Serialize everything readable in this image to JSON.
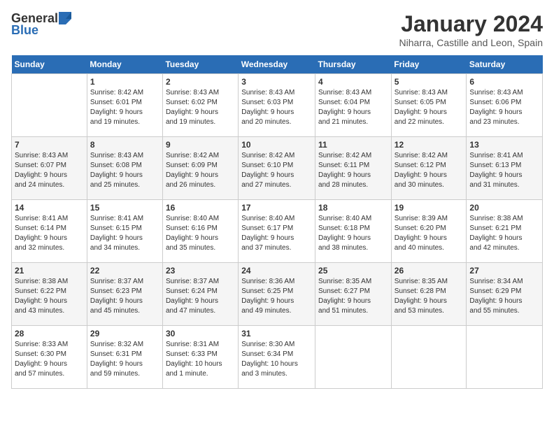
{
  "logo": {
    "general": "General",
    "blue": "Blue"
  },
  "title": "January 2024",
  "subtitle": "Niharra, Castille and Leon, Spain",
  "days_of_week": [
    "Sunday",
    "Monday",
    "Tuesday",
    "Wednesday",
    "Thursday",
    "Friday",
    "Saturday"
  ],
  "weeks": [
    [
      {
        "day": "",
        "info": ""
      },
      {
        "day": "1",
        "info": "Sunrise: 8:42 AM\nSunset: 6:01 PM\nDaylight: 9 hours\nand 19 minutes."
      },
      {
        "day": "2",
        "info": "Sunrise: 8:43 AM\nSunset: 6:02 PM\nDaylight: 9 hours\nand 19 minutes."
      },
      {
        "day": "3",
        "info": "Sunrise: 8:43 AM\nSunset: 6:03 PM\nDaylight: 9 hours\nand 20 minutes."
      },
      {
        "day": "4",
        "info": "Sunrise: 8:43 AM\nSunset: 6:04 PM\nDaylight: 9 hours\nand 21 minutes."
      },
      {
        "day": "5",
        "info": "Sunrise: 8:43 AM\nSunset: 6:05 PM\nDaylight: 9 hours\nand 22 minutes."
      },
      {
        "day": "6",
        "info": "Sunrise: 8:43 AM\nSunset: 6:06 PM\nDaylight: 9 hours\nand 23 minutes."
      }
    ],
    [
      {
        "day": "7",
        "info": "Sunrise: 8:43 AM\nSunset: 6:07 PM\nDaylight: 9 hours\nand 24 minutes."
      },
      {
        "day": "8",
        "info": "Sunrise: 8:43 AM\nSunset: 6:08 PM\nDaylight: 9 hours\nand 25 minutes."
      },
      {
        "day": "9",
        "info": "Sunrise: 8:42 AM\nSunset: 6:09 PM\nDaylight: 9 hours\nand 26 minutes."
      },
      {
        "day": "10",
        "info": "Sunrise: 8:42 AM\nSunset: 6:10 PM\nDaylight: 9 hours\nand 27 minutes."
      },
      {
        "day": "11",
        "info": "Sunrise: 8:42 AM\nSunset: 6:11 PM\nDaylight: 9 hours\nand 28 minutes."
      },
      {
        "day": "12",
        "info": "Sunrise: 8:42 AM\nSunset: 6:12 PM\nDaylight: 9 hours\nand 30 minutes."
      },
      {
        "day": "13",
        "info": "Sunrise: 8:41 AM\nSunset: 6:13 PM\nDaylight: 9 hours\nand 31 minutes."
      }
    ],
    [
      {
        "day": "14",
        "info": "Sunrise: 8:41 AM\nSunset: 6:14 PM\nDaylight: 9 hours\nand 32 minutes."
      },
      {
        "day": "15",
        "info": "Sunrise: 8:41 AM\nSunset: 6:15 PM\nDaylight: 9 hours\nand 34 minutes."
      },
      {
        "day": "16",
        "info": "Sunrise: 8:40 AM\nSunset: 6:16 PM\nDaylight: 9 hours\nand 35 minutes."
      },
      {
        "day": "17",
        "info": "Sunrise: 8:40 AM\nSunset: 6:17 PM\nDaylight: 9 hours\nand 37 minutes."
      },
      {
        "day": "18",
        "info": "Sunrise: 8:40 AM\nSunset: 6:18 PM\nDaylight: 9 hours\nand 38 minutes."
      },
      {
        "day": "19",
        "info": "Sunrise: 8:39 AM\nSunset: 6:20 PM\nDaylight: 9 hours\nand 40 minutes."
      },
      {
        "day": "20",
        "info": "Sunrise: 8:38 AM\nSunset: 6:21 PM\nDaylight: 9 hours\nand 42 minutes."
      }
    ],
    [
      {
        "day": "21",
        "info": "Sunrise: 8:38 AM\nSunset: 6:22 PM\nDaylight: 9 hours\nand 43 minutes."
      },
      {
        "day": "22",
        "info": "Sunrise: 8:37 AM\nSunset: 6:23 PM\nDaylight: 9 hours\nand 45 minutes."
      },
      {
        "day": "23",
        "info": "Sunrise: 8:37 AM\nSunset: 6:24 PM\nDaylight: 9 hours\nand 47 minutes."
      },
      {
        "day": "24",
        "info": "Sunrise: 8:36 AM\nSunset: 6:25 PM\nDaylight: 9 hours\nand 49 minutes."
      },
      {
        "day": "25",
        "info": "Sunrise: 8:35 AM\nSunset: 6:27 PM\nDaylight: 9 hours\nand 51 minutes."
      },
      {
        "day": "26",
        "info": "Sunrise: 8:35 AM\nSunset: 6:28 PM\nDaylight: 9 hours\nand 53 minutes."
      },
      {
        "day": "27",
        "info": "Sunrise: 8:34 AM\nSunset: 6:29 PM\nDaylight: 9 hours\nand 55 minutes."
      }
    ],
    [
      {
        "day": "28",
        "info": "Sunrise: 8:33 AM\nSunset: 6:30 PM\nDaylight: 9 hours\nand 57 minutes."
      },
      {
        "day": "29",
        "info": "Sunrise: 8:32 AM\nSunset: 6:31 PM\nDaylight: 9 hours\nand 59 minutes."
      },
      {
        "day": "30",
        "info": "Sunrise: 8:31 AM\nSunset: 6:33 PM\nDaylight: 10 hours\nand 1 minute."
      },
      {
        "day": "31",
        "info": "Sunrise: 8:30 AM\nSunset: 6:34 PM\nDaylight: 10 hours\nand 3 minutes."
      },
      {
        "day": "",
        "info": ""
      },
      {
        "day": "",
        "info": ""
      },
      {
        "day": "",
        "info": ""
      }
    ]
  ]
}
